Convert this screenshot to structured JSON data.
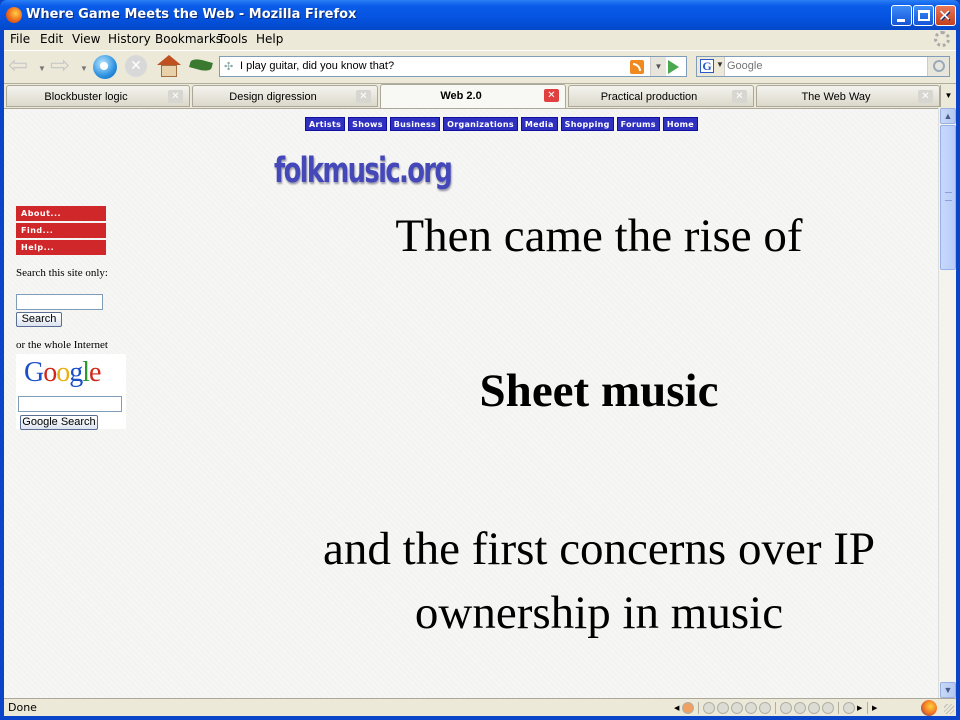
{
  "window": {
    "title": "Where Game Meets the Web - Mozilla Firefox",
    "controls": [
      "minimize",
      "maximize",
      "close"
    ]
  },
  "menubar": {
    "items": [
      {
        "label": "File",
        "accel": "F"
      },
      {
        "label": "Edit",
        "accel": "E"
      },
      {
        "label": "View",
        "accel": "V"
      },
      {
        "label": "History",
        "accel": "s"
      },
      {
        "label": "Bookmarks",
        "accel": "B"
      },
      {
        "label": "Tools",
        "accel": "T"
      },
      {
        "label": "Help",
        "accel": "H"
      }
    ]
  },
  "navbar": {
    "url": "I play guitar, did you know that?",
    "search_placeholder": "Google",
    "search_engine": "G"
  },
  "tabs": [
    {
      "label": "Blockbuster logic",
      "active": false
    },
    {
      "label": "Design digression",
      "active": false
    },
    {
      "label": "Web 2.0",
      "active": true
    },
    {
      "label": "Practical production",
      "active": false
    },
    {
      "label": "The Web Way",
      "active": false
    }
  ],
  "page": {
    "topnav": [
      "Artists",
      "Shows",
      "Business",
      "Organizations",
      "Media",
      "Shopping",
      "Forums",
      "Home"
    ],
    "logo": "folkmusic.org",
    "sidemenu": [
      "About...",
      "Find...",
      "Help..."
    ],
    "search_site_label": "Search this site only:",
    "search_button": "Search",
    "internet_label": "or the whole Internet",
    "google_logo": "Google",
    "google_search_button": "Google Search",
    "slide": {
      "line1": "Then came the rise of",
      "line2": "Sheet music",
      "line3": "and the first concerns over IP",
      "line4": "ownership in music"
    }
  },
  "statusbar": {
    "status": "Done"
  },
  "colors": {
    "titlebar": "#0553e0",
    "topnav_bg": "#3030c0",
    "sidemenu_bg": "#d0282a",
    "logo": "#4448b8"
  }
}
